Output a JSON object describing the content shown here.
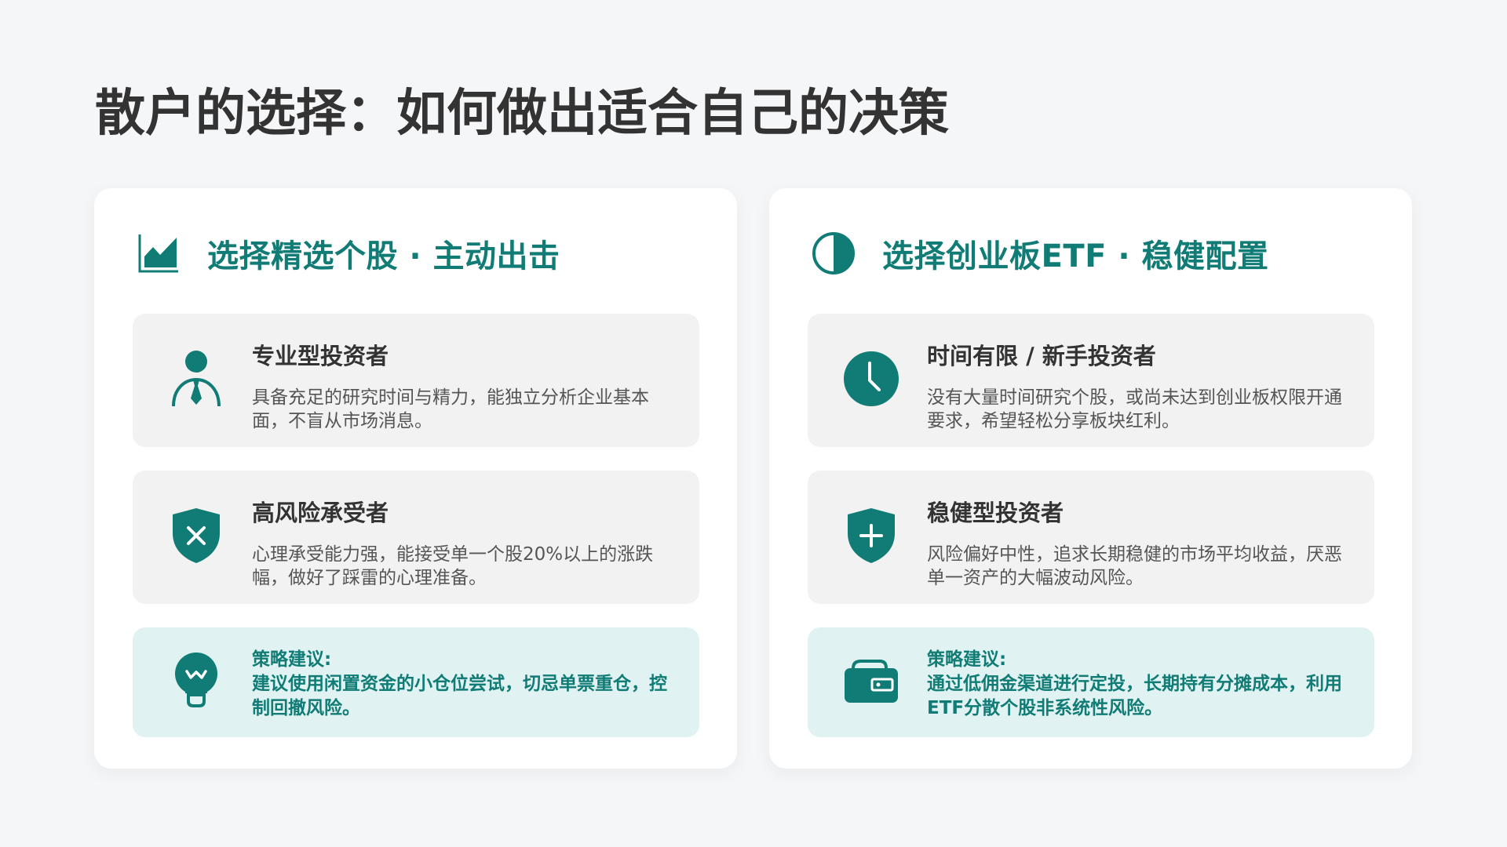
{
  "page": {
    "title": "散户的选择：如何做出适合自己的决策"
  },
  "colors": {
    "accent": "#117c75",
    "background": "#f5f6f8",
    "card_grey": "#f2f2f3",
    "card_tip": "#e0f2f1",
    "text_dark": "#333333"
  },
  "panels": [
    {
      "header_icon": "area-chart-icon",
      "title": "选择精选个股 · 主动出击",
      "cards": [
        {
          "icon": "person-with-tie-icon",
          "title": "专业型投资者",
          "desc": "具备充足的研究时间与精力，能独立分析企业基本面，不盲从市场消息。"
        },
        {
          "icon": "shield-x-icon",
          "title": "高风险承受者",
          "desc": "心理承受能力强，能接受单一个股20%以上的涨跌幅，做好了踩雷的心理准备。"
        }
      ],
      "tip": {
        "icon": "lightbulb-icon",
        "label": "策略建议:",
        "text": "建议使用闲置资金的小仓位尝试，切忌单票重仓，控制回撤风险。"
      }
    },
    {
      "header_icon": "half-circle-icon",
      "title": "选择创业板ETF · 稳健配置",
      "cards": [
        {
          "icon": "clock-icon",
          "title": "时间有限 / 新手投资者",
          "desc": "没有大量时间研究个股，或尚未达到创业板权限开通要求，希望轻松分享板块红利。"
        },
        {
          "icon": "shield-plus-icon",
          "title": "稳健型投资者",
          "desc": "风险偏好中性，追求长期稳健的市场平均收益，厌恶单一资产的大幅波动风险。"
        }
      ],
      "tip": {
        "icon": "wallet-icon",
        "label": "策略建议:",
        "text": "通过低佣金渠道进行定投，长期持有分摊成本，利用ETF分散个股非系统性风险。"
      }
    }
  ]
}
